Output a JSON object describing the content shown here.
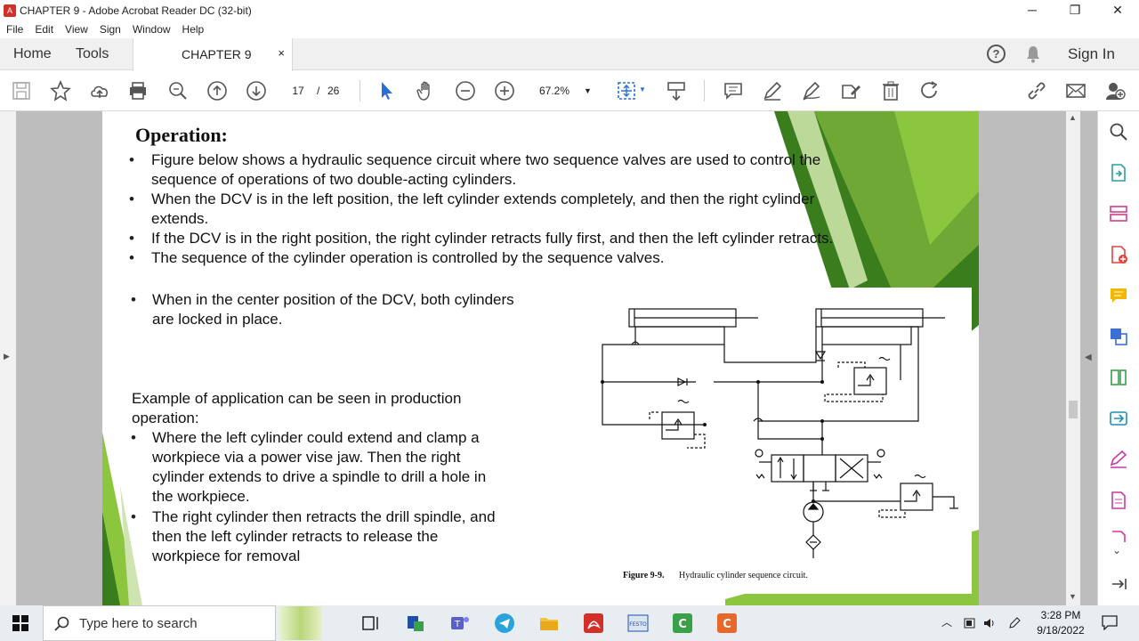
{
  "window": {
    "title": "CHAPTER 9 - Adobe Acrobat Reader DC (32-bit)",
    "minimize": "─",
    "restore": "❐",
    "close": "✕"
  },
  "menu": [
    "File",
    "Edit",
    "View",
    "Sign",
    "Window",
    "Help"
  ],
  "tabs": {
    "home": "Home",
    "tools": "Tools",
    "doc": "CHAPTER 9",
    "close": "×",
    "help": "?",
    "signin": "Sign In"
  },
  "toolbar": {
    "page_current": "17",
    "page_sep": "/",
    "page_total": "26",
    "zoom": "67.2%"
  },
  "slide": {
    "heading": "Operation:",
    "bullets": [
      "Figure below shows a hydraulic sequence circuit where two sequence valves are used to control the",
      "sequence of operations of two double-acting cylinders.",
      "When the DCV is in the left position, the left cylinder extends completely, and then the right cylinder",
      "extends.",
      "If the DCV is in the right position, the right cylinder retracts fully first, and then the left cylinder retracts.",
      "The sequence of the cylinder operation is controlled by the sequence valves."
    ],
    "center_bullet_1": "When in the center position of the DCV, both cylinders",
    "center_bullet_2": "are locked in place.",
    "example_1": "Example of application can be seen in production",
    "example_2": "operation:",
    "app_bullets": [
      "Where the left cylinder could extend and clamp a",
      "workpiece via a power vise jaw. Then the right",
      "cylinder extends to drive a spindle to drill a hole in",
      "the workpiece.",
      "The right cylinder then retracts the drill spindle, and",
      "then the left cylinder retracts to release the",
      "workpiece for removal"
    ],
    "bullet_glyph": "•",
    "figure_label": "Figure 9-9.",
    "figure_caption": "Hydraulic cylinder sequence circuit."
  },
  "taskbar": {
    "search_placeholder": "Type here to search",
    "time": "3:28 PM",
    "date": "9/18/2022"
  },
  "colors": {
    "accent_green": "#8cc63f",
    "dark_green": "#3a7d1c",
    "adobe_red": "#d4302a"
  }
}
